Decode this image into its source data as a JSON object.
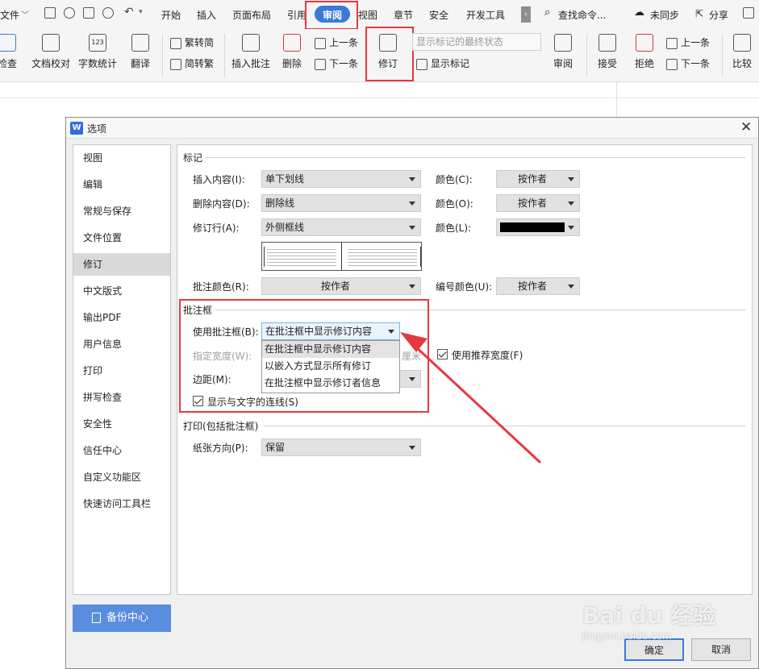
{
  "menubar": {
    "file": "文件",
    "items": [
      "开始",
      "插入",
      "页面布局",
      "引用",
      "审阅",
      "视图",
      "章节",
      "安全",
      "开发工具"
    ],
    "active": "审阅",
    "search": "查找命令...",
    "sync": "未同步",
    "share": "分享"
  },
  "ribbon": {
    "check": "检查",
    "doc_proof": "文档校对",
    "word_count": "字数统计",
    "translate": "翻译",
    "trad_to_simp": "繁转简",
    "simp_to_trad": "简转繁",
    "insert_comment": "插入批注",
    "delete": "删除",
    "prev": "上一条",
    "next": "下一条",
    "track": "修订",
    "markup_state": "显示标记的最终状态",
    "show_markup": "显示标记",
    "review": "审阅",
    "accept": "接受",
    "reject": "拒绝",
    "prev2": "上一条",
    "next2": "下一条",
    "compare": "比较"
  },
  "dialog": {
    "title": "选项",
    "nav": [
      "视图",
      "编辑",
      "常规与保存",
      "文件位置",
      "修订",
      "中文版式",
      "输出PDF",
      "用户信息",
      "打印",
      "拼写检查",
      "安全性",
      "信任中心",
      "自定义功能区",
      "快速访问工具栏"
    ],
    "nav_selected": "修订",
    "backup": "备份中心",
    "ok": "确定",
    "cancel": "取消",
    "marks": {
      "header": "标记",
      "insert_label": "插入内容(I):",
      "insert_value": "单下划线",
      "delete_label": "删除内容(D):",
      "delete_value": "删除线",
      "line_label": "修订行(A):",
      "line_value": "外侧框线",
      "color_c_label": "颜色(C):",
      "color_c_value": "按作者",
      "color_o_label": "颜色(O):",
      "color_o_value": "按作者",
      "color_l_label": "颜色(L):",
      "color_l_swatch": "#000000",
      "comment_color_label": "批注颜色(R):",
      "comment_color_value": "按作者",
      "number_color_label": "编号颜色(U):",
      "number_color_value": "按作者"
    },
    "balloons": {
      "header": "批注框",
      "use_label": "使用批注框(B):",
      "use_value": "在批注框中显示修订内容",
      "options": [
        "在批注框中显示修订内容",
        "以嵌入方式显示所有修订",
        "在批注框中显示修订者信息"
      ],
      "width_label": "指定宽度(W):",
      "width_unit_partial": "厘米",
      "recommended_width": "使用推荐宽度(F)",
      "margin_label": "边距(M):",
      "connect_lines": "显示与文字的连线(S)"
    },
    "print": {
      "header": "打印(包括批注框)",
      "orientation_label": "纸张方向(P):",
      "orientation_value": "保留"
    }
  },
  "watermark": {
    "brand": "Bai du 经验",
    "url": "jingyan.baidu.com"
  },
  "colors": {
    "highlight_red": "#e8383d",
    "active_tab": "#3a7ad8",
    "backup_button": "#5a8de0",
    "dropdown_highlight": "#cce4f7"
  }
}
